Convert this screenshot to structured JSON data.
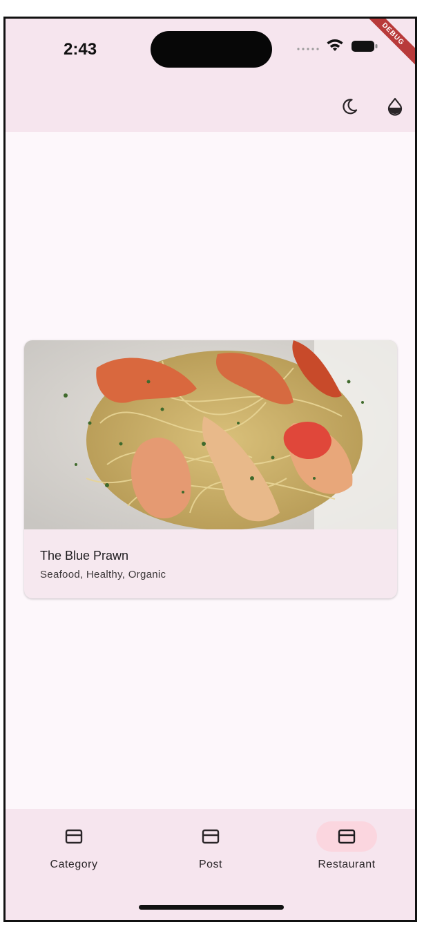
{
  "status_bar": {
    "time": "2:43",
    "debug_label": "DEBUG"
  },
  "app_bar": {
    "actions": [
      {
        "icon": "moon-icon",
        "label": "dark-mode-toggle"
      },
      {
        "icon": "drop-icon",
        "label": "color-theme"
      }
    ]
  },
  "card": {
    "title": "The Blue Prawn",
    "subtitle": "Seafood, Healthy, Organic",
    "image": "seafood-pasta-photo"
  },
  "bottom_nav": {
    "items": [
      {
        "label": "Category",
        "icon": "card-icon",
        "active": false
      },
      {
        "label": "Post",
        "icon": "card-icon",
        "active": false
      },
      {
        "label": "Restaurant",
        "icon": "card-icon",
        "active": true
      }
    ]
  },
  "colors": {
    "background": "#fdf7fb",
    "surface": "#f6e5ee",
    "active_indicator": "#fbd6df",
    "debug_banner": "#b83a3a"
  }
}
